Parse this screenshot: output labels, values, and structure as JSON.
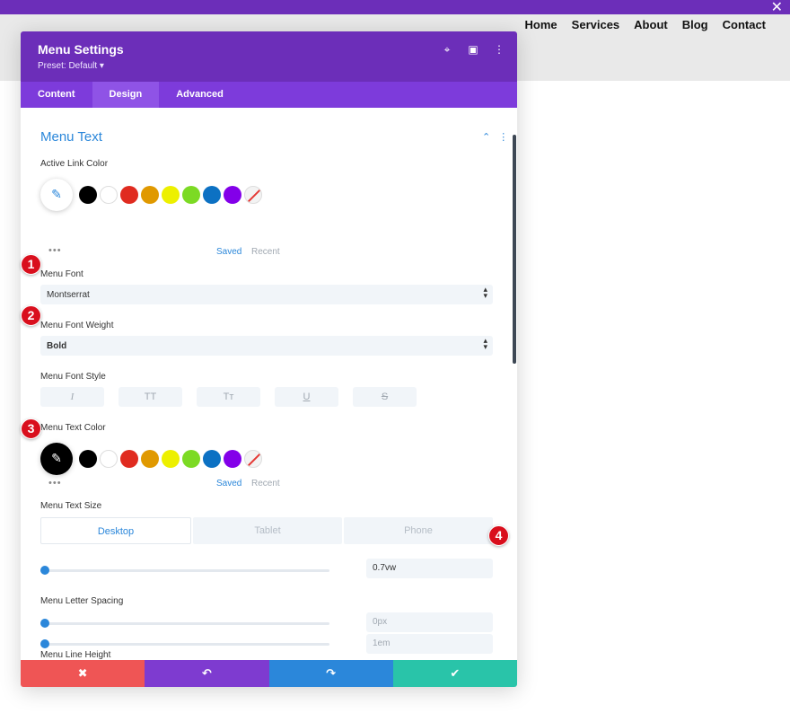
{
  "site": {
    "nav": [
      "Home",
      "Services",
      "About",
      "Blog",
      "Contact"
    ],
    "close_icon": "close-icon"
  },
  "modal": {
    "title": "Menu Settings",
    "preset": "Preset: Default ▾",
    "header_icons": [
      "screenshot-icon",
      "layout-icon",
      "more-icon"
    ],
    "tabs": [
      "Content",
      "Design",
      "Advanced"
    ],
    "active_tab": "Design"
  },
  "section": {
    "title": "Menu Text",
    "icons": [
      "chevron-up-icon",
      "more-vertical-icon"
    ]
  },
  "active_link_color": {
    "label": "Active Link Color",
    "swatches": [
      "#000000",
      "#ffffff",
      "#e02b20",
      "#e09900",
      "#edf000",
      "#7cda24",
      "#0c71c3",
      "#8300e9"
    ],
    "saved": "Saved",
    "recent": "Recent",
    "more": "•••"
  },
  "menu_font": {
    "label": "Menu Font",
    "value": "Montserrat"
  },
  "menu_font_weight": {
    "label": "Menu Font Weight",
    "value": "Bold"
  },
  "menu_font_style": {
    "label": "Menu Font Style",
    "buttons": [
      "I",
      "TT",
      "Tт",
      "U",
      "S"
    ]
  },
  "menu_text_color": {
    "label": "Menu Text Color",
    "selected": "#000000",
    "swatches": [
      "#000000",
      "#ffffff",
      "#e02b20",
      "#e09900",
      "#edf000",
      "#7cda24",
      "#0c71c3",
      "#8300e9"
    ],
    "saved": "Saved",
    "recent": "Recent",
    "more": "•••"
  },
  "menu_text_size": {
    "label": "Menu Text Size",
    "devices": [
      "Desktop",
      "Tablet",
      "Phone"
    ],
    "active_device": "Desktop",
    "value": "0.7vw"
  },
  "menu_letter_spacing": {
    "label": "Menu Letter Spacing",
    "value": "0px"
  },
  "menu_line_height": {
    "label": "Menu Line Height",
    "value": "1em"
  },
  "footer": {
    "cancel": "✖",
    "undo": "↶",
    "redo": "↷",
    "save": "✔"
  },
  "markers": [
    "1",
    "2",
    "3",
    "4"
  ]
}
